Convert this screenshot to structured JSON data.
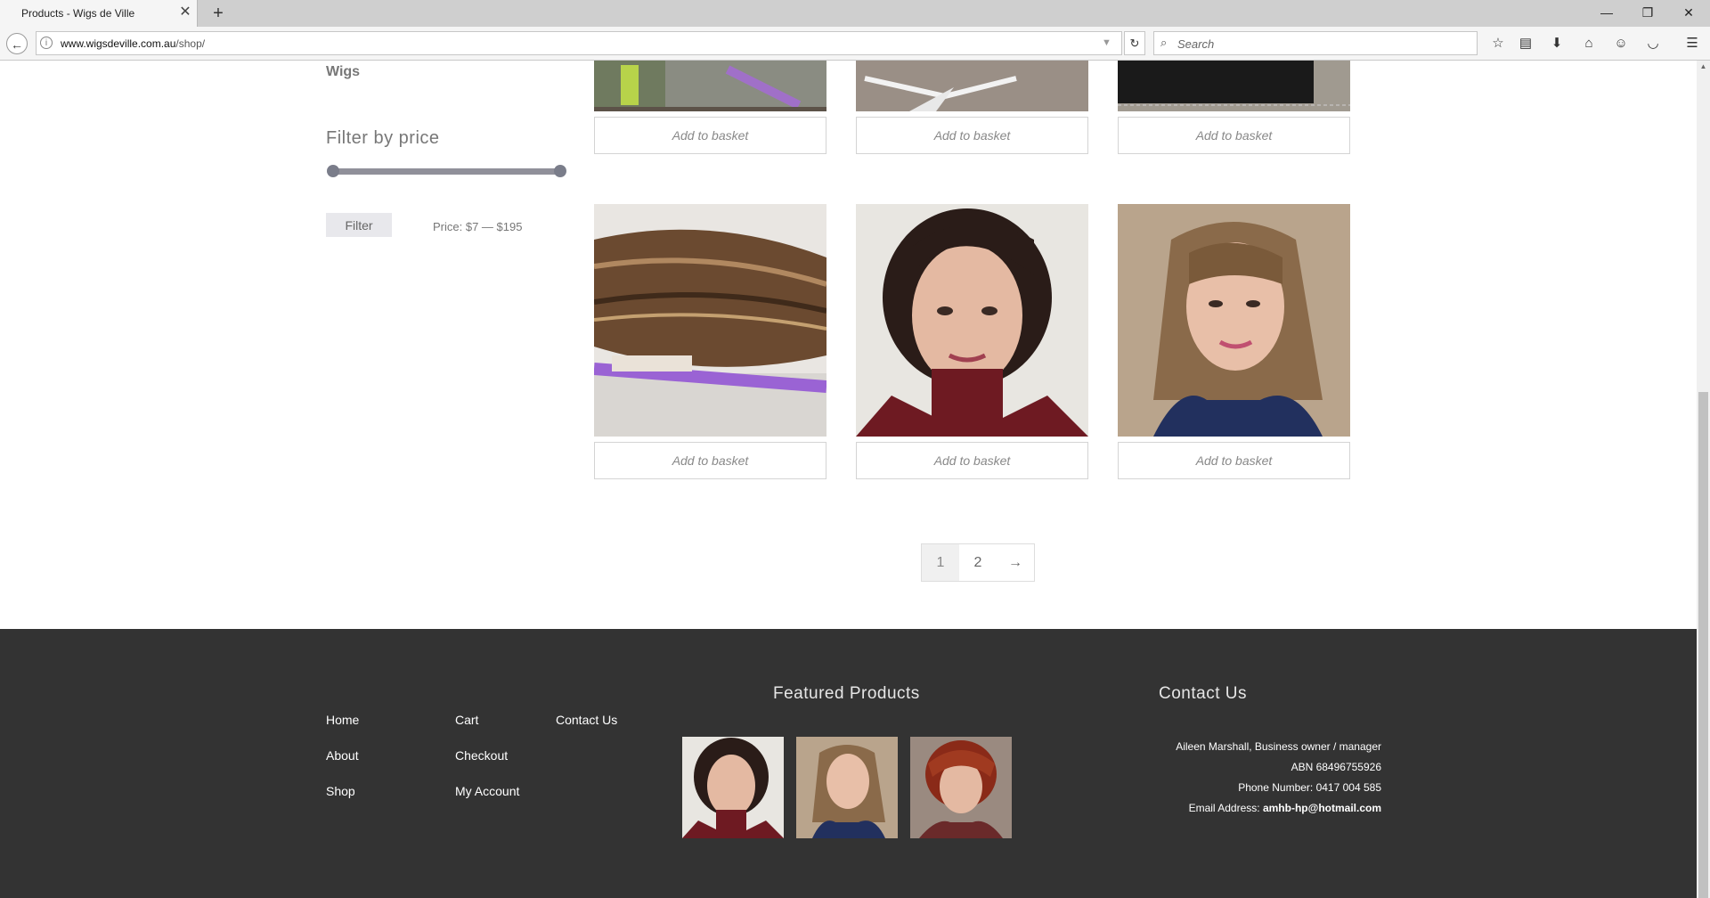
{
  "browser": {
    "tab_title": "Products - Wigs de Ville",
    "url_domain": "www.wigsdeville.com.au",
    "url_path": "/shop/",
    "search_placeholder": "Search"
  },
  "sidebar": {
    "category_link": "Wigs",
    "filter_heading": "Filter by price",
    "filter_button": "Filter",
    "price_text": "Price: $7 — $195",
    "price_range": {
      "min": 7,
      "max": 195,
      "selected_min": 7,
      "selected_max": 195
    }
  },
  "products": {
    "basket_label": "Add to basket"
  },
  "pagination": {
    "pages": [
      "1",
      "2"
    ],
    "current": "1",
    "next": "→"
  },
  "footer": {
    "links_col1": [
      "Home",
      "About",
      "Shop"
    ],
    "links_col2": [
      "Cart",
      "Checkout",
      "My Account"
    ],
    "links_col3": [
      "Contact Us"
    ],
    "featured_heading": "Featured Products",
    "contact_heading": "Contact Us",
    "contact_lines": [
      "Aileen Marshall, Business owner / manager",
      "ABN 68496755926",
      "Phone Number: 0417 004 585"
    ],
    "email_label": "Email Address: ",
    "email": "amhb-hp@hotmail.com"
  }
}
